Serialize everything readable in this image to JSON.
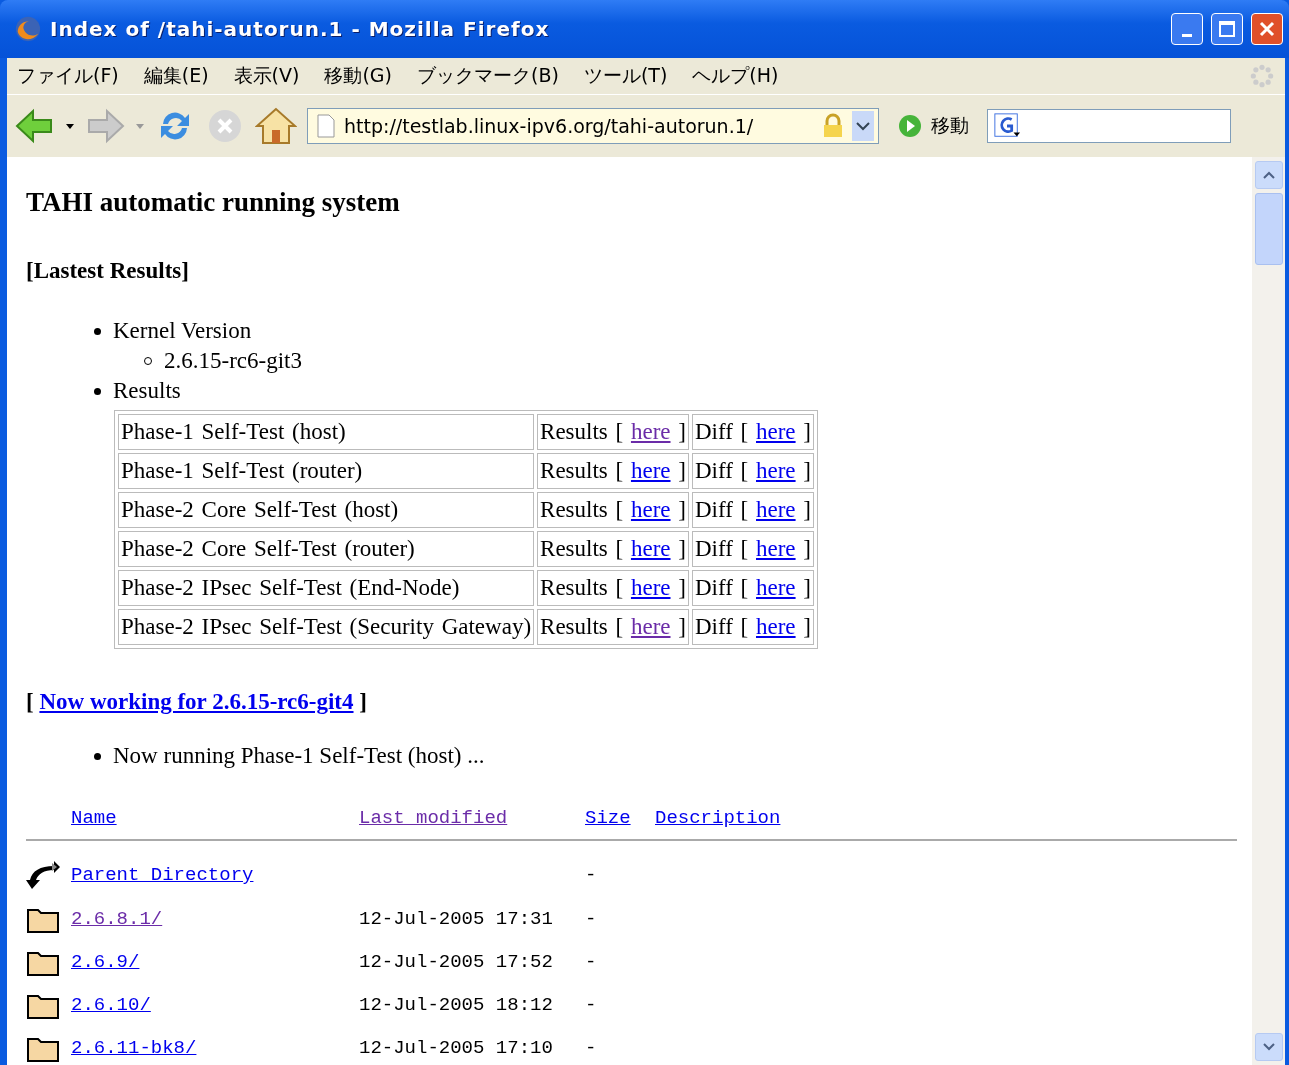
{
  "window": {
    "title": "Index of /tahi-autorun.1 - Mozilla Firefox"
  },
  "menu": [
    "ファイル(F)",
    "編集(E)",
    "表示(V)",
    "移動(G)",
    "ブックマーク(B)",
    "ツール(T)",
    "ヘルプ(H)"
  ],
  "toolbar": {
    "address": "http://testlab.linux-ipv6.org/tahi-autorun.1/",
    "go_label": "移動"
  },
  "page": {
    "heading": "TAHI automatic running system",
    "section_title": "[Lastest Results]",
    "summary": [
      {
        "label": "Kernel Version",
        "children": [
          {
            "label": "2.6.15-rc6-git3"
          }
        ]
      },
      {
        "label": "Results"
      }
    ],
    "results": [
      {
        "test": "Phase-1 Self-Test (host)",
        "results": {
          "before": "Results  [",
          "link": "here",
          "after": "]",
          "visited": true
        },
        "diff": {
          "before": "Diff  [",
          "link": "here",
          "after": "]",
          "visited": false
        }
      },
      {
        "test": "Phase-1 Self-Test (router)",
        "results": {
          "before": "Results  [",
          "link": "here",
          "after": "]",
          "visited": false
        },
        "diff": {
          "before": "Diff  [",
          "link": "here",
          "after": "]",
          "visited": false
        }
      },
      {
        "test": "Phase-2 Core Self-Test (host)",
        "results": {
          "before": "Results  [",
          "link": "here",
          "after": "]",
          "visited": false
        },
        "diff": {
          "before": "Diff  [",
          "link": "here",
          "after": "]",
          "visited": false
        }
      },
      {
        "test": "Phase-2 Core Self-Test (router)",
        "results": {
          "before": "Results  [",
          "link": "here",
          "after": "]",
          "visited": false
        },
        "diff": {
          "before": "Diff  [",
          "link": "here",
          "after": "]",
          "visited": false
        }
      },
      {
        "test": "Phase-2 IPsec Self-Test (End-Node)",
        "results": {
          "before": "Results  [",
          "link": "here",
          "after": "]",
          "visited": false
        },
        "diff": {
          "before": "Diff  [",
          "link": "here",
          "after": "]",
          "visited": false
        }
      },
      {
        "test": "Phase-2 IPsec Self-Test (Security Gateway)",
        "results": {
          "before": "Results  [",
          "link": "here",
          "after": "]",
          "visited": true
        },
        "diff": {
          "before": "Diff  [",
          "link": "here",
          "after": "]",
          "visited": false
        }
      }
    ],
    "working": {
      "before": "[",
      "link": "Now working for 2.6.15-rc6-git4",
      "after": "]"
    },
    "status": [
      "Now running Phase-1 Self-Test (host) ..."
    ]
  },
  "listing": {
    "columns": [
      {
        "label": "Name",
        "visited": false
      },
      {
        "label": "Last modified",
        "visited": true
      },
      {
        "label": "Size",
        "visited": false
      },
      {
        "label": "Description",
        "visited": false
      }
    ],
    "rows": [
      {
        "kind": "parent",
        "name": "Parent Directory",
        "visited": false,
        "size": "-"
      },
      {
        "kind": "folder",
        "name": "2.6.8.1/",
        "visited": true,
        "modified": "12-Jul-2005 17:31",
        "size": "-"
      },
      {
        "kind": "folder",
        "name": "2.6.9/",
        "visited": false,
        "modified": "12-Jul-2005 17:52",
        "size": "-"
      },
      {
        "kind": "folder",
        "name": "2.6.10/",
        "visited": false,
        "modified": "12-Jul-2005 18:12",
        "size": "-"
      },
      {
        "kind": "folder",
        "name": "2.6.11-bk8/",
        "visited": false,
        "modified": "12-Jul-2005 17:10",
        "size": "-"
      }
    ]
  }
}
